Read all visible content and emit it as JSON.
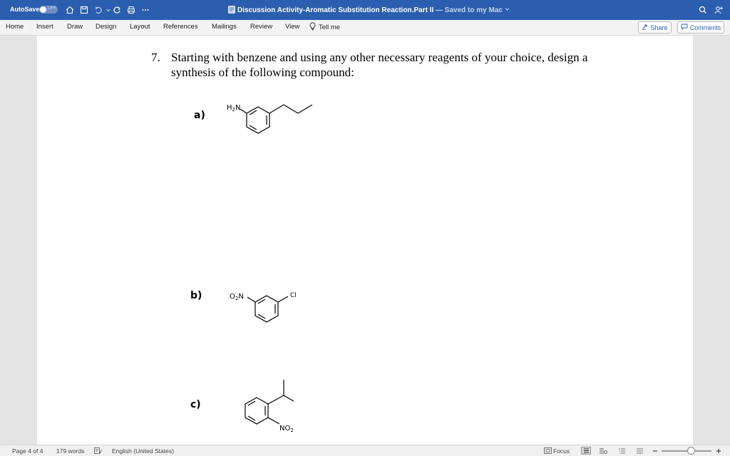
{
  "titlebar": {
    "autosave_label": "AutoSave",
    "autosave_state": "OFF",
    "doc_name": "Discussion Activity-Aromatic Substitution Reaction.Part II",
    "separator": " — ",
    "saved_status": "Saved to my Mac",
    "accent_color": "#2b5eaf",
    "icons": [
      "home-icon",
      "save-icon",
      "undo-icon",
      "redo-icon",
      "print-icon",
      "more-icon",
      "search-icon",
      "share-people-icon"
    ]
  },
  "ribbon": {
    "tabs": [
      "Home",
      "Insert",
      "Draw",
      "Design",
      "Layout",
      "References",
      "Mailings",
      "Review",
      "View"
    ],
    "tell_me": "Tell me",
    "share_label": "Share",
    "comments_label": "Comments"
  },
  "document": {
    "question_number": "7.",
    "question_text": "Starting with benzene and using any other necessary reagents of your choice, design a synthesis of the following compound:",
    "parts": [
      {
        "label": "a)",
        "substituents": [
          "H2N",
          "propyl"
        ]
      },
      {
        "label": "b)",
        "substituents": [
          "O2N",
          "Cl"
        ]
      },
      {
        "label": "c)",
        "substituents": [
          "isopropyl",
          "NO2"
        ]
      }
    ]
  },
  "statusbar": {
    "page": "Page 4 of 4",
    "words": "179 words",
    "language": "English (United States)",
    "focus": "Focus"
  }
}
